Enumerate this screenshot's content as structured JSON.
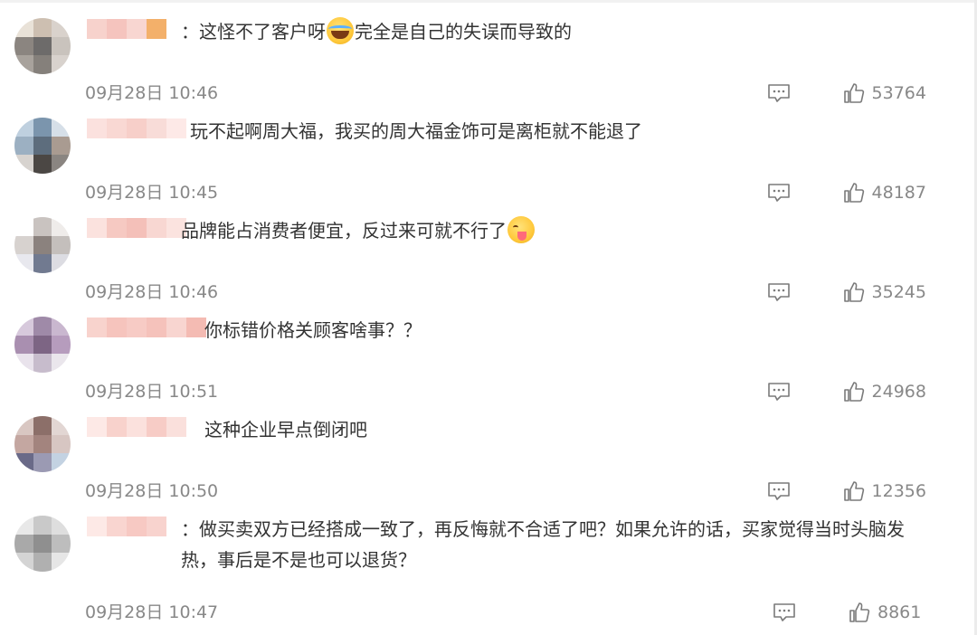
{
  "comments": [
    {
      "text": "：这怪不了客户呀",
      "emoji": "laugh-cry-emoji",
      "text2": "完全是自己的失误而导致的",
      "time": "09月28日 10:46",
      "likes": "53764",
      "avatar": [
        "#e9e2d8",
        "#cdbfb1",
        "#d9d2cc",
        "#8b8580",
        "#6d6b6a",
        "#c9c3bd",
        "#a8a29c",
        "#85807b",
        "#d8d2cd"
      ],
      "name_blocks": [
        "#f7d2cc",
        "#f5c4be",
        "#f8d6d1",
        "#f3b06a"
      ]
    },
    {
      "text": "玩不起啊周大福，我买的周大福金饰可是离柜就不能退了",
      "emoji": "",
      "text2": "",
      "time": "09月28日 10:45",
      "likes": "48187",
      "avatar": [
        "#bfd0df",
        "#7b95ad",
        "#d6dfe8",
        "#9cb0c2",
        "#5d6d7d",
        "#a99b91",
        "#d7d3cf",
        "#4b4744",
        "#8a8581"
      ],
      "name_blocks": [
        "#fbe1de",
        "#f9d8d3",
        "#f7cfc9",
        "#f8dcd8",
        "#fde9e7"
      ]
    },
    {
      "text": "品牌能占消费者便宜，反过来可就不行了",
      "emoji": "yum-emoji",
      "text2": "",
      "time": "09月28日 10:46",
      "likes": "35245",
      "avatar": [
        "#ffffff",
        "#c9c3c0",
        "#efecea",
        "#d7d2cf",
        "#8b827e",
        "#c4bfbc",
        "#e8e8ee",
        "#717a90",
        "#dcdce2"
      ],
      "name_blocks": [
        "#fbe2de",
        "#f6c9c2",
        "#f4c0b9",
        "#f8d7d2",
        "#fbe3df"
      ]
    },
    {
      "text": "你标错价格关顾客啥事？？",
      "emoji": "",
      "text2": "",
      "time": "09月28日 10:51",
      "likes": "24968",
      "avatar": [
        "#d7c9dc",
        "#9f8aa8",
        "#c9b7cf",
        "#a98fb0",
        "#7d6584",
        "#b69cbd",
        "#e9e3ec",
        "#c7bccc",
        "#eae6ec"
      ],
      "name_blocks": [
        "#f8d3cd",
        "#f6c4bd",
        "#f7cbc5",
        "#f5c2bb",
        "#f8d5d0",
        "#f4bbb3"
      ]
    },
    {
      "text": "这种企业早点倒闭吧",
      "emoji": "",
      "text2": "",
      "time": "09月28日 10:50",
      "likes": "12356",
      "avatar": [
        "#d9c7c2",
        "#8c6f69",
        "#e2d6d3",
        "#c4a7a1",
        "#a3847e",
        "#d7c6c2",
        "#6a6a88",
        "#9b9ab3",
        "#c3d2e2"
      ],
      "name_blocks": [
        "#fde9e6",
        "#f8d2cc",
        "#fbe1dd",
        "#f7ccc6",
        "#fae0dc"
      ]
    },
    {
      "text": "：做买卖双方已经搭成一致了，再反悔就不合适了吧？如果允许的话，买家觉得当时头脑发热，事后是不是也可以退货？",
      "emoji": "",
      "text2": "",
      "time": "09月28日 10:47",
      "likes": "8861",
      "avatar": [
        "#e8e8e8",
        "#c9c9c9",
        "#dedede",
        "#a9a9a9",
        "#8f8f8f",
        "#bdbdbd",
        "#d4d4d4",
        "#b0b0b0",
        "#e6e6e6"
      ],
      "name_blocks": [
        "#fde9e6",
        "#f9d5d0",
        "#f7c9c3",
        "#f8d3ce"
      ]
    }
  ]
}
